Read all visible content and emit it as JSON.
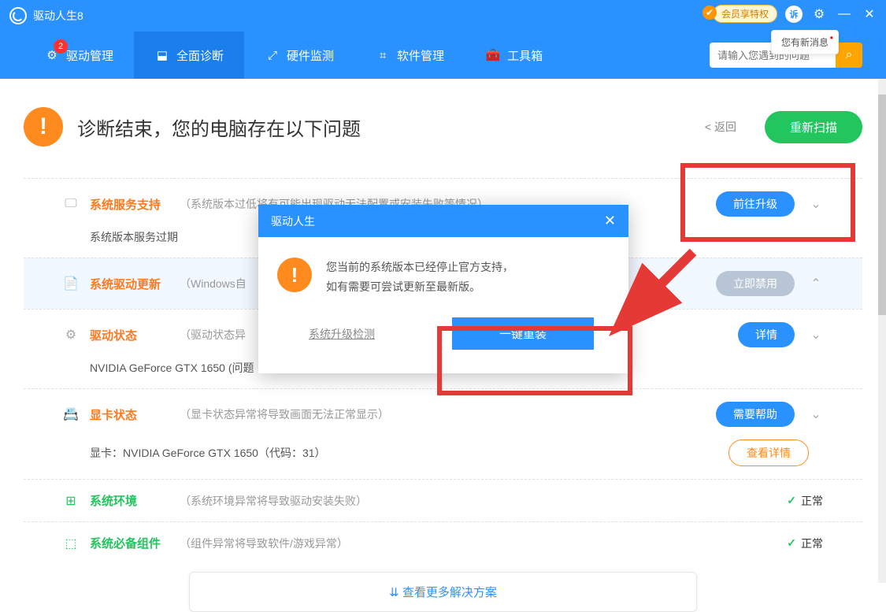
{
  "titlebar": {
    "app_name": "驱动人生8",
    "vip": "会员享特权",
    "new_msg": "您有新消息"
  },
  "nav": {
    "items": [
      {
        "label": "驱动管理",
        "badge": "2"
      },
      {
        "label": "全面诊断"
      },
      {
        "label": "硬件监测"
      },
      {
        "label": "软件管理"
      },
      {
        "label": "工具箱"
      }
    ],
    "search_placeholder": "请输入您遇到的问题"
  },
  "header": {
    "title": "诊断结束，您的电脑存在以下问题",
    "back": "< 返回",
    "rescan": "重新扫描"
  },
  "items": [
    {
      "label": "系统服务支持",
      "desc": "（系统版本过低将有可能出现驱动无法配置或安装失败等情况）",
      "action": "前往升级",
      "action_class": "btn-blue",
      "label_class": "orange",
      "sub": "系统版本服务过期"
    },
    {
      "label": "系统驱动更新",
      "desc": "（Windows自",
      "action": "立即禁用",
      "action_class": "btn-gray",
      "label_class": "orange",
      "highlighted": true
    },
    {
      "label": "驱动状态",
      "desc": "（驱动状态异",
      "action": "详情",
      "action_class": "btn-blue",
      "label_class": "orange",
      "sub": "NVIDIA GeForce GTX 1650 (问题"
    },
    {
      "label": "显卡状态",
      "desc": "（显卡状态异常将导致画面无法正常显示）",
      "action": "需要帮助",
      "action_class": "btn-blue",
      "label_class": "orange",
      "sub": "显卡：NVIDIA GeForce GTX 1650（代码：31）",
      "sub_tag": "查看详情"
    },
    {
      "label": "系统环境",
      "desc": "（系统环境异常将导致驱动安装失败）",
      "status": "正常",
      "label_class": "green"
    },
    {
      "label": "系统必备组件",
      "desc": "（组件异常将导致软件/游戏异常）",
      "status": "正常",
      "label_class": "green"
    }
  ],
  "more": "查看更多解决方案",
  "dialog": {
    "title": "驱动人生",
    "line1": "您当前的系统版本已经停止官方支持，",
    "line2": "如有需要可尝试更新至最新版。",
    "link": "系统升级检测",
    "button": "一键重装"
  }
}
